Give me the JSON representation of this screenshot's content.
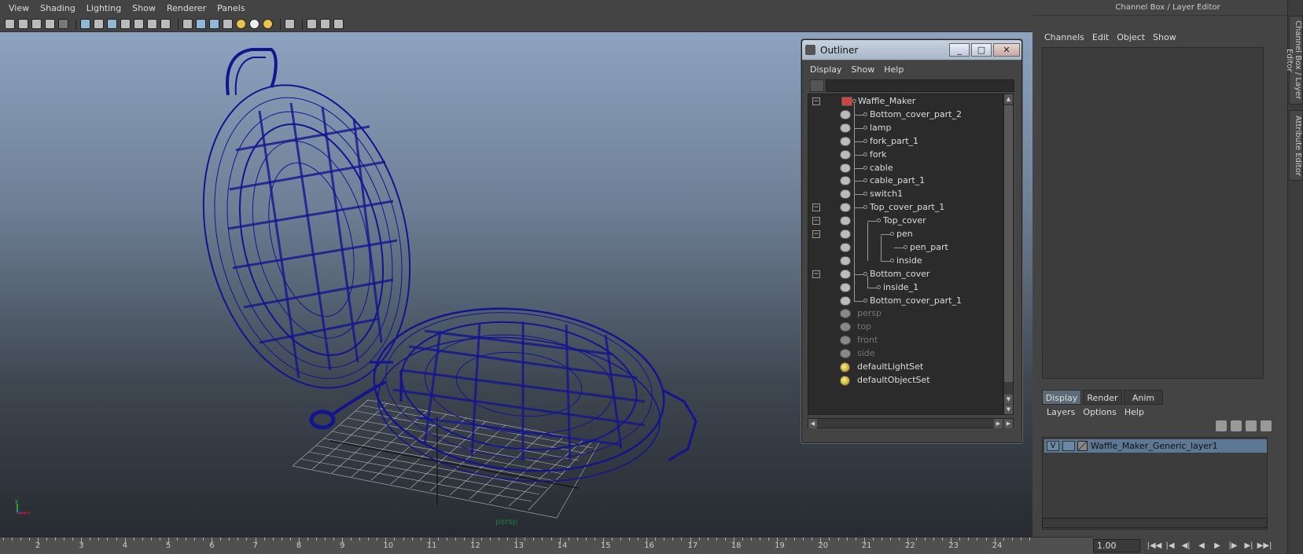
{
  "viewport": {
    "menu": [
      "View",
      "Shading",
      "Lighting",
      "Show",
      "Renderer",
      "Panels"
    ],
    "camera_label": "persp",
    "axis_labels": {
      "y": "y",
      "x": "x"
    }
  },
  "outliner": {
    "title": "Outliner",
    "menu": [
      "Display",
      "Show",
      "Help"
    ],
    "filter_placeholder": "",
    "window_buttons": {
      "minimize": "_",
      "maximize": "□",
      "close": "✕"
    },
    "items": [
      {
        "label": "Waffle_Maker",
        "depth": 0,
        "icon": "group",
        "expander": "−"
      },
      {
        "label": "Bottom_cover_part_2",
        "depth": 1,
        "icon": "mesh"
      },
      {
        "label": "lamp",
        "depth": 1,
        "icon": "mesh"
      },
      {
        "label": "fork_part_1",
        "depth": 1,
        "icon": "mesh"
      },
      {
        "label": "fork",
        "depth": 1,
        "icon": "mesh"
      },
      {
        "label": "cable",
        "depth": 1,
        "icon": "mesh"
      },
      {
        "label": "cable_part_1",
        "depth": 1,
        "icon": "mesh"
      },
      {
        "label": "switch1",
        "depth": 1,
        "icon": "mesh"
      },
      {
        "label": "Top_cover_part_1",
        "depth": 1,
        "icon": "mesh",
        "expander": "−"
      },
      {
        "label": "Top_cover",
        "depth": 2,
        "icon": "mesh",
        "expander": "−"
      },
      {
        "label": "pen",
        "depth": 3,
        "icon": "mesh",
        "expander": "−"
      },
      {
        "label": "pen_part",
        "depth": 4,
        "icon": "mesh"
      },
      {
        "label": "inside",
        "depth": 3,
        "icon": "mesh"
      },
      {
        "label": "Bottom_cover",
        "depth": 1,
        "icon": "mesh",
        "expander": "−"
      },
      {
        "label": "inside_1",
        "depth": 2,
        "icon": "mesh"
      },
      {
        "label": "Bottom_cover_part_1",
        "depth": 1,
        "icon": "mesh"
      },
      {
        "label": "persp",
        "depth": 0,
        "icon": "camera",
        "dim": true
      },
      {
        "label": "top",
        "depth": 0,
        "icon": "camera",
        "dim": true
      },
      {
        "label": "front",
        "depth": 0,
        "icon": "camera",
        "dim": true
      },
      {
        "label": "side",
        "depth": 0,
        "icon": "camera",
        "dim": true
      },
      {
        "label": "defaultLightSet",
        "depth": 0,
        "icon": "set"
      },
      {
        "label": "defaultObjectSet",
        "depth": 0,
        "icon": "set"
      }
    ]
  },
  "right_panel": {
    "title": "Channel Box / Layer Editor",
    "menu": [
      "Channels",
      "Edit",
      "Object",
      "Show"
    ],
    "tabs": [
      "Display",
      "Render",
      "Anim"
    ],
    "active_tab": "Display",
    "layer_menu": [
      "Layers",
      "Options",
      "Help"
    ],
    "layer": {
      "visible": "V",
      "name": "Waffle_Maker_Generic_layer1"
    },
    "side_tabs": [
      "Channel Box / Layer Editor",
      "Attribute Editor"
    ]
  },
  "timeline": {
    "frames": [
      "2",
      "3",
      "4",
      "5",
      "6",
      "7",
      "8",
      "9",
      "10",
      "11",
      "12",
      "13",
      "14",
      "15",
      "16",
      "17",
      "18",
      "19",
      "20",
      "21",
      "22",
      "23",
      "24"
    ],
    "current_frame": "1.00"
  },
  "colors": {
    "wireframe": "#0a0a8a",
    "viewport_top": "#8da3bf",
    "viewport_bottom": "#272b31",
    "selection": "#5d7894"
  }
}
